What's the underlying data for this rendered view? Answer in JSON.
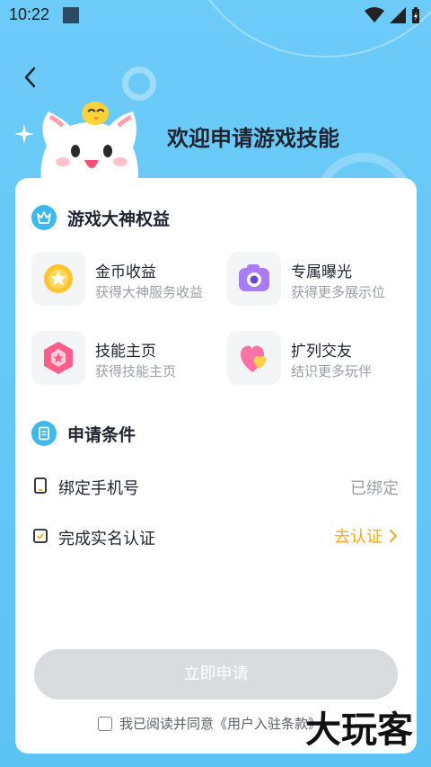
{
  "status_bar": {
    "time": "10:22"
  },
  "header": {
    "title": "欢迎申请游戏技能"
  },
  "benefits": {
    "title": "游戏大神权益",
    "items": [
      {
        "title": "金币收益",
        "subtitle": "获得大神服务收益",
        "icon": "gold-coin-icon"
      },
      {
        "title": "专属曝光",
        "subtitle": "获得更多展示位",
        "icon": "camera-icon"
      },
      {
        "title": "技能主页",
        "subtitle": "获得技能主页",
        "icon": "star-hexagon-icon"
      },
      {
        "title": "扩列交友",
        "subtitle": "结识更多玩伴",
        "icon": "heart-icon"
      }
    ]
  },
  "conditions": {
    "title": "申请条件",
    "items": [
      {
        "label": "绑定手机号",
        "status": "已绑定"
      },
      {
        "label": "完成实名认证",
        "action": "去认证"
      }
    ]
  },
  "apply_button": {
    "label": "立即申请"
  },
  "agreement": {
    "text": "我已阅读并同意《用户入驻条款》"
  },
  "watermark": "大玩客",
  "colors": {
    "accent": "#3fb8ee",
    "action": "#f2a81d",
    "background": "#63c8f7",
    "button_disabled": "#d9dbde"
  }
}
